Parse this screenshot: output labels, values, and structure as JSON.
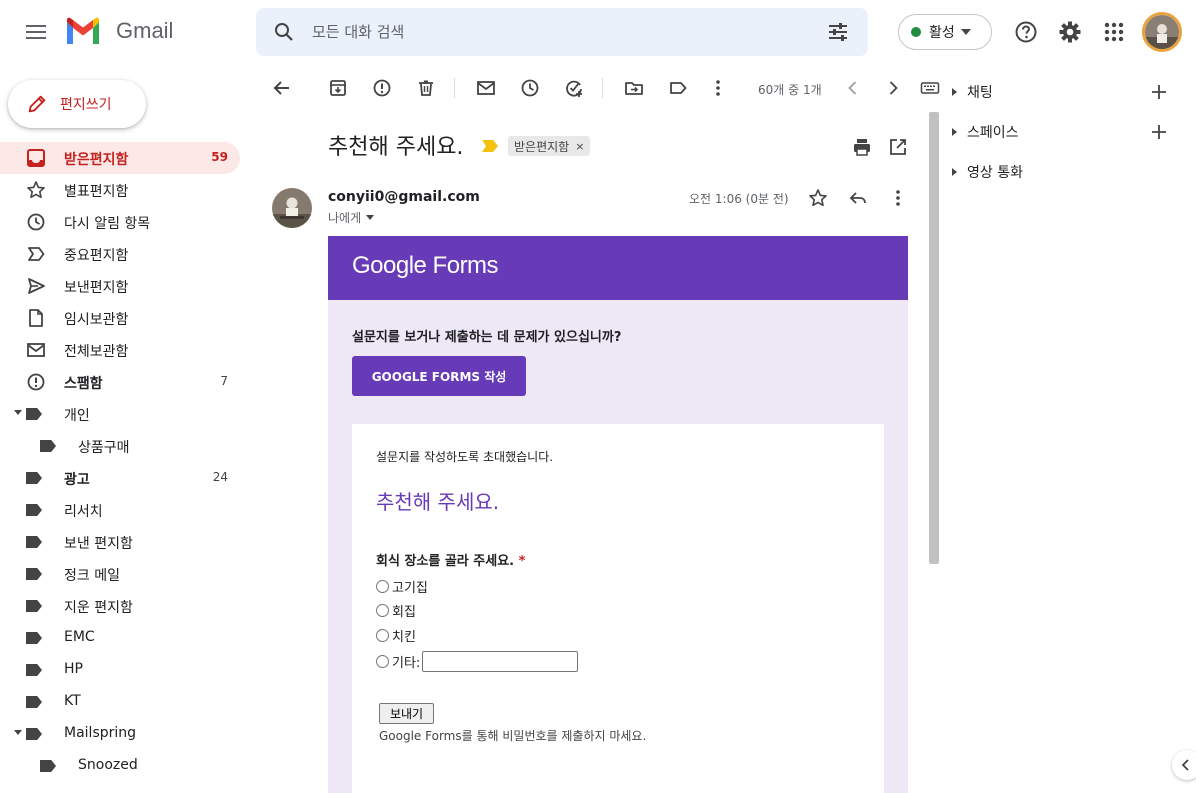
{
  "app": {
    "brand": "Gmail"
  },
  "search": {
    "placeholder": "모든 대화 검색"
  },
  "status": {
    "label": "활성",
    "color": "#1e8e3e"
  },
  "compose": {
    "label": "편지쓰기"
  },
  "sidebar": {
    "items": [
      {
        "label": "받은편지함",
        "count": "59",
        "icon": "inbox-icon",
        "active": true
      },
      {
        "label": "별표편지함",
        "count": "",
        "icon": "star-icon"
      },
      {
        "label": "다시 알림 항목",
        "count": "",
        "icon": "clock-icon"
      },
      {
        "label": "중요편지함",
        "count": "",
        "icon": "important-icon"
      },
      {
        "label": "보낸편지함",
        "count": "",
        "icon": "send-icon"
      },
      {
        "label": "임시보관함",
        "count": "",
        "icon": "draft-icon"
      },
      {
        "label": "전체보관함",
        "count": "",
        "icon": "mail-icon"
      },
      {
        "label": "스팸함",
        "count": "7",
        "icon": "spam-icon",
        "bold": true
      },
      {
        "label": "개인",
        "count": "",
        "icon": "label-icon",
        "expandable": true
      },
      {
        "label": "상품구매",
        "count": "",
        "icon": "label-icon",
        "nested": true
      },
      {
        "label": "광고",
        "count": "24",
        "icon": "label-icon",
        "bold": true
      },
      {
        "label": "리서치",
        "count": "",
        "icon": "label-icon"
      },
      {
        "label": "보낸 편지함",
        "count": "",
        "icon": "label-icon"
      },
      {
        "label": "정크 메일",
        "count": "",
        "icon": "label-icon"
      },
      {
        "label": "지운 편지함",
        "count": "",
        "icon": "label-icon"
      },
      {
        "label": "EMC",
        "count": "",
        "icon": "label-icon"
      },
      {
        "label": "HP",
        "count": "",
        "icon": "label-icon"
      },
      {
        "label": "KT",
        "count": "",
        "icon": "label-icon"
      },
      {
        "label": "Mailspring",
        "count": "",
        "icon": "label-icon",
        "expandable": true
      },
      {
        "label": "Snoozed",
        "count": "",
        "icon": "label-icon",
        "nested": true
      }
    ]
  },
  "toolbar": {
    "pager": "60개 중 1개"
  },
  "message": {
    "subject": "추천해 주세요.",
    "label_chip": "받은편지함",
    "label_chip_remove": "×",
    "sender": "conyii0@gmail.com",
    "to": "나에게",
    "time": "오전 1:06 (0분 전)"
  },
  "email": {
    "logo": "Google Forms",
    "trouble": "설문지를 보거나 제출하는 데 문제가 있으십니까?",
    "forms_button": "GOOGLE FORMS 작성",
    "invite": "설문지를 작성하도록 초대했습니다.",
    "form_title": "추천해 주세요.",
    "question": "회식 장소를 골라 주세요.",
    "required_mark": "*",
    "options": [
      "고기집",
      "회집",
      "치킨",
      "기타:"
    ],
    "send": "보내기",
    "password_note": "Google Forms를 통해 비밀번호를 제출하지 마세요."
  },
  "side_panel": {
    "items": [
      {
        "label": "채팅"
      },
      {
        "label": "스페이스"
      },
      {
        "label": "영상 통화"
      }
    ]
  },
  "colors": {
    "accent": "#c5221f",
    "forms_purple": "#673ab7",
    "forms_bg": "#ede7f6"
  }
}
